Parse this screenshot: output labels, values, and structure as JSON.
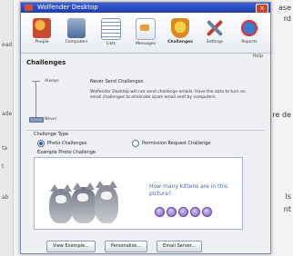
{
  "background": {
    "left_texts": [
      "ead",
      "ade",
      "ta",
      "t",
      "ab"
    ],
    "right_texts": [
      "ase",
      "rd",
      "re de",
      "ls",
      "nt"
    ]
  },
  "window": {
    "title": "Wolfender Desktop",
    "close_symbol": "×"
  },
  "toolbar": {
    "items": [
      {
        "label": "People",
        "icon": "people-icon"
      },
      {
        "label": "Computers",
        "icon": "computer-icon"
      },
      {
        "label": "Lists",
        "icon": "lists-icon"
      },
      {
        "label": "Messages",
        "icon": "messages-icon"
      },
      {
        "label": "Challenges",
        "icon": "challenges-icon",
        "active": true
      },
      {
        "label": "Settings",
        "icon": "settings-icon"
      },
      {
        "label": "Reports",
        "icon": "reports-icon"
      }
    ]
  },
  "main": {
    "help": "Help",
    "title": "Challenges",
    "slider": {
      "top_label": "Always",
      "bottom_label": "Never",
      "level": "Never"
    },
    "level_title": "Never Send Challenges",
    "level_description": "Wolfender Desktop will not send challenge emails. Have the data to turn on email challenges to eliminate spam email sent by computers.",
    "group_label": "Challenge Type",
    "radio_photo": "Photo Challenges",
    "radio_request": "Permission Request Challenge",
    "example_label": "Example Photo Challenge",
    "example_question": "How many kittens are in this picture?",
    "buttons": {
      "view_example": "View Example...",
      "personalize": "Personalize...",
      "email_server": "Email Server..."
    }
  }
}
